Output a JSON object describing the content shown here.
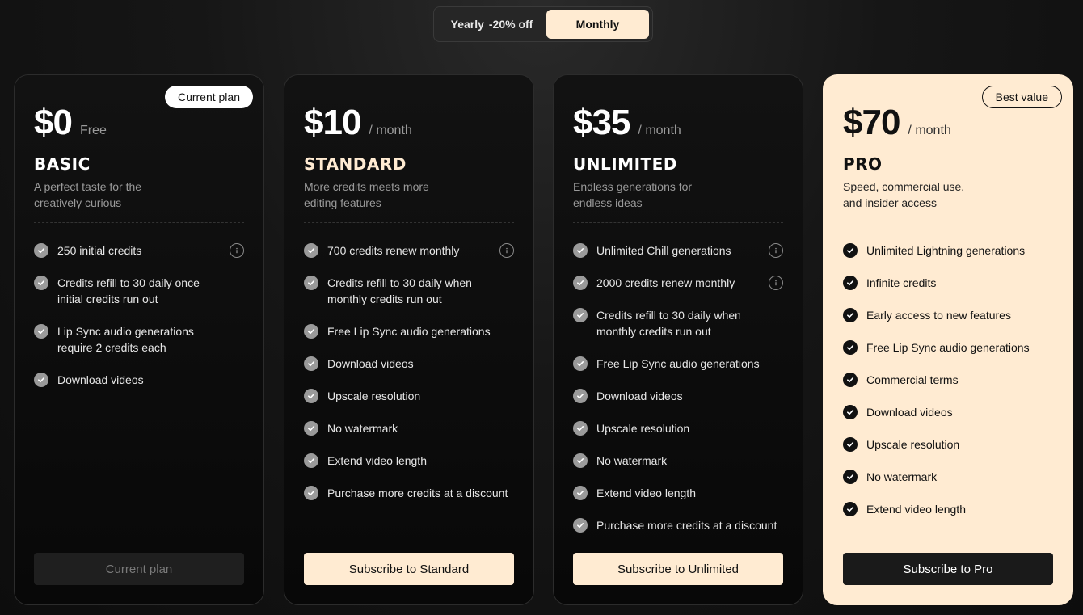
{
  "toggle": {
    "yearly_label": "Yearly",
    "yearly_discount": "-20% off",
    "monthly_label": "Monthly",
    "selected": "Monthly"
  },
  "colors": {
    "accent": "#ffebd2",
    "background": "#0d0d0d",
    "card_border": "#2c2c2c"
  },
  "plans": [
    {
      "badge": "Current plan",
      "price": "$0",
      "period": "Free",
      "name": "BASIC",
      "desc": "A perfect taste for the creatively curious",
      "features": [
        {
          "text": "250 initial credits",
          "info": true
        },
        {
          "text": "Credits refill to 30 daily once initial credits run out",
          "info": false
        },
        {
          "text": "Lip Sync audio generations require 2 credits each",
          "info": false
        },
        {
          "text": "Download videos",
          "info": false
        }
      ],
      "cta": "Current plan"
    },
    {
      "badge": "",
      "price": "$10",
      "period": "/ month",
      "name": "STANDARD",
      "desc": "More credits meets more editing features",
      "features": [
        {
          "text": "700 credits renew monthly",
          "info": true
        },
        {
          "text": "Credits refill to 30 daily when monthly credits run out",
          "info": false
        },
        {
          "text": "Free Lip Sync audio generations",
          "info": false
        },
        {
          "text": "Download videos",
          "info": false
        },
        {
          "text": "Upscale resolution",
          "info": false
        },
        {
          "text": "No watermark",
          "info": false
        },
        {
          "text": "Extend video length",
          "info": false
        },
        {
          "text": "Purchase more credits at a discount",
          "info": false
        }
      ],
      "cta": "Subscribe to Standard"
    },
    {
      "badge": "",
      "price": "$35",
      "period": "/ month",
      "name": "UNLIMITED",
      "desc": "Endless generations for endless ideas",
      "features": [
        {
          "text": "Unlimited Chill generations",
          "info": true
        },
        {
          "text": "2000 credits renew monthly",
          "info": true
        },
        {
          "text": "Credits refill to 30 daily when monthly credits run out",
          "info": false
        },
        {
          "text": "Free Lip Sync audio generations",
          "info": false
        },
        {
          "text": "Download videos",
          "info": false
        },
        {
          "text": "Upscale resolution",
          "info": false
        },
        {
          "text": "No watermark",
          "info": false
        },
        {
          "text": "Extend video length",
          "info": false
        },
        {
          "text": "Purchase more credits at a discount",
          "info": false
        }
      ],
      "cta": "Subscribe to Unlimited"
    },
    {
      "badge": "Best value",
      "price": "$70",
      "period": "/ month",
      "name": "PRO",
      "desc": "Speed, commercial use, and insider access",
      "features": [
        {
          "text": "Unlimited Lightning generations",
          "info": false
        },
        {
          "text": "Infinite credits",
          "info": false
        },
        {
          "text": "Early access to new features",
          "info": false
        },
        {
          "text": "Free Lip Sync audio generations",
          "info": false
        },
        {
          "text": "Commercial terms",
          "info": false
        },
        {
          "text": "Download videos",
          "info": false
        },
        {
          "text": "Upscale resolution",
          "info": false
        },
        {
          "text": "No watermark",
          "info": false
        },
        {
          "text": "Extend video length",
          "info": false
        }
      ],
      "cta": "Subscribe to Pro"
    }
  ]
}
